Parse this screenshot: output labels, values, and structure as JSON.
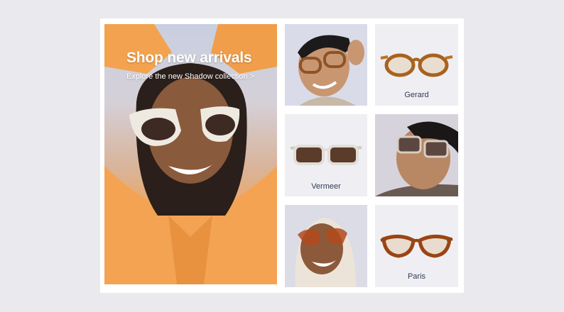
{
  "hero": {
    "title": "Shop new arrivals",
    "subtitle": "Explore the new Shadow collection",
    "arrow": ">"
  },
  "products": [
    {
      "name": "Gerard"
    },
    {
      "name": "Vermeer"
    },
    {
      "name": "Paris"
    }
  ],
  "colors": {
    "page_background": "#e9e9ee",
    "card_background": "#ffffff",
    "hero_orange": "#f2a052",
    "label_text": "#2f3b55",
    "product_tile": "#efeff3"
  }
}
